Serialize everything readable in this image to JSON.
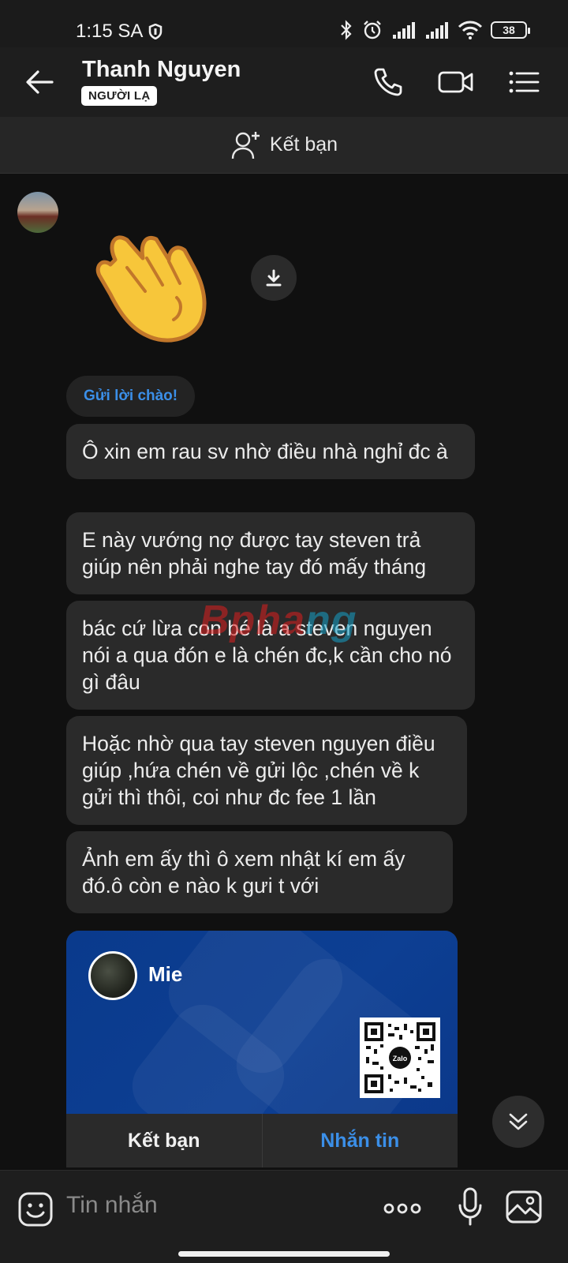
{
  "status_bar": {
    "time": "1:15 SA",
    "battery": "38"
  },
  "header": {
    "contact_name": "Thanh Nguyen",
    "badge": "NGƯỜI LẠ"
  },
  "add_friend_banner": {
    "label": "Kết bạn"
  },
  "chat": {
    "sticker": "waving-hand",
    "greet_chip": "Gửi lời chào!",
    "messages": [
      "Ô xin em rau sv nhờ điều nhà nghỉ đc à",
      "E này vướng nợ được tay steven  trả giúp nên phải nghe tay đó mấy tháng",
      "bác cứ lừa con bé là a steven nguyen nói a qua đón e là chén đc,k cần cho nó gì đâu",
      "Hoặc nhờ qua tay steven nguyen điều giúp ,hứa chén về gửi lộc ,chén về k gửi thì thôi, coi như đc fee 1 lần",
      "Ảnh em ấy thì ô xem nhật kí em ấy đó.ô còn e nào k gưi t với"
    ],
    "watermark": {
      "part1": "Bpha",
      "part2": "ng"
    },
    "contact_card": {
      "name": "Mie",
      "qr_label": "Zalo",
      "add_friend_label": "Kết bạn",
      "message_label": "Nhắn tin"
    }
  },
  "input_bar": {
    "placeholder": "Tin nhắn"
  },
  "colors": {
    "accent": "#3b8fe8",
    "bubble": "#2a2a2a",
    "card_blue": "#0d3f93"
  }
}
